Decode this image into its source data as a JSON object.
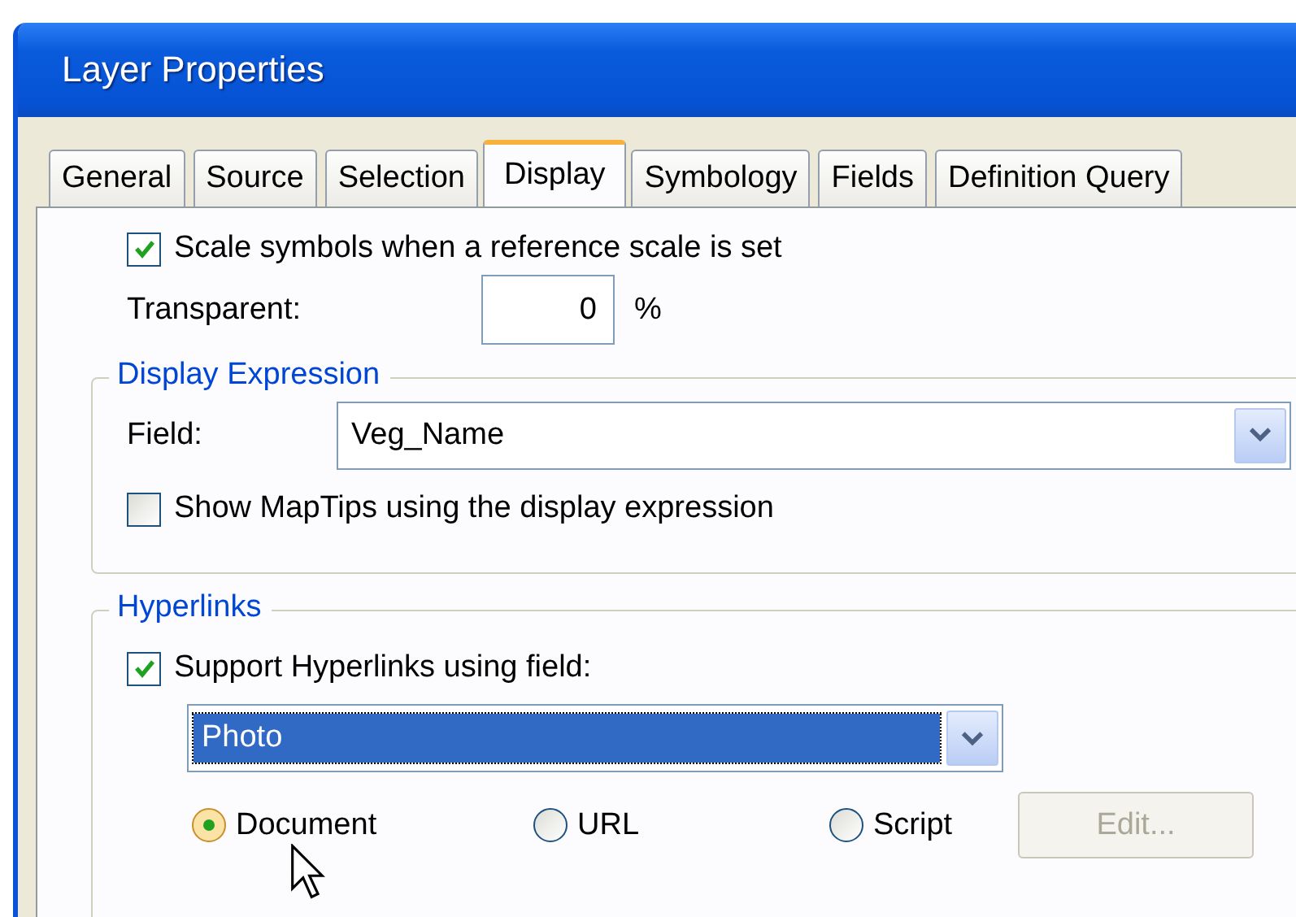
{
  "window": {
    "title": "Layer Properties"
  },
  "tabs": [
    {
      "label": "General",
      "selected": false
    },
    {
      "label": "Source",
      "selected": false
    },
    {
      "label": "Selection",
      "selected": false
    },
    {
      "label": "Display",
      "selected": true
    },
    {
      "label": "Symbology",
      "selected": false
    },
    {
      "label": "Fields",
      "selected": false
    },
    {
      "label": "Definition Query",
      "selected": false
    }
  ],
  "scale_symbols": {
    "label": "Scale symbols when a reference scale is set",
    "checked": true
  },
  "transparent": {
    "label": "Transparent:",
    "value": "0",
    "unit": "%"
  },
  "display_expression": {
    "title": "Display Expression",
    "field_label": "Field:",
    "field_value": "Veg_Name",
    "show_maptips": {
      "label": "Show MapTips using the display expression",
      "checked": false
    }
  },
  "hyperlinks": {
    "title": "Hyperlinks",
    "support": {
      "label": "Support Hyperlinks using field:",
      "checked": true
    },
    "field_value": "Photo",
    "options": [
      {
        "label": "Document",
        "selected": true
      },
      {
        "label": "URL",
        "selected": false
      },
      {
        "label": "Script",
        "selected": false
      }
    ],
    "edit_button": {
      "label": "Edit...",
      "disabled": true
    }
  }
}
